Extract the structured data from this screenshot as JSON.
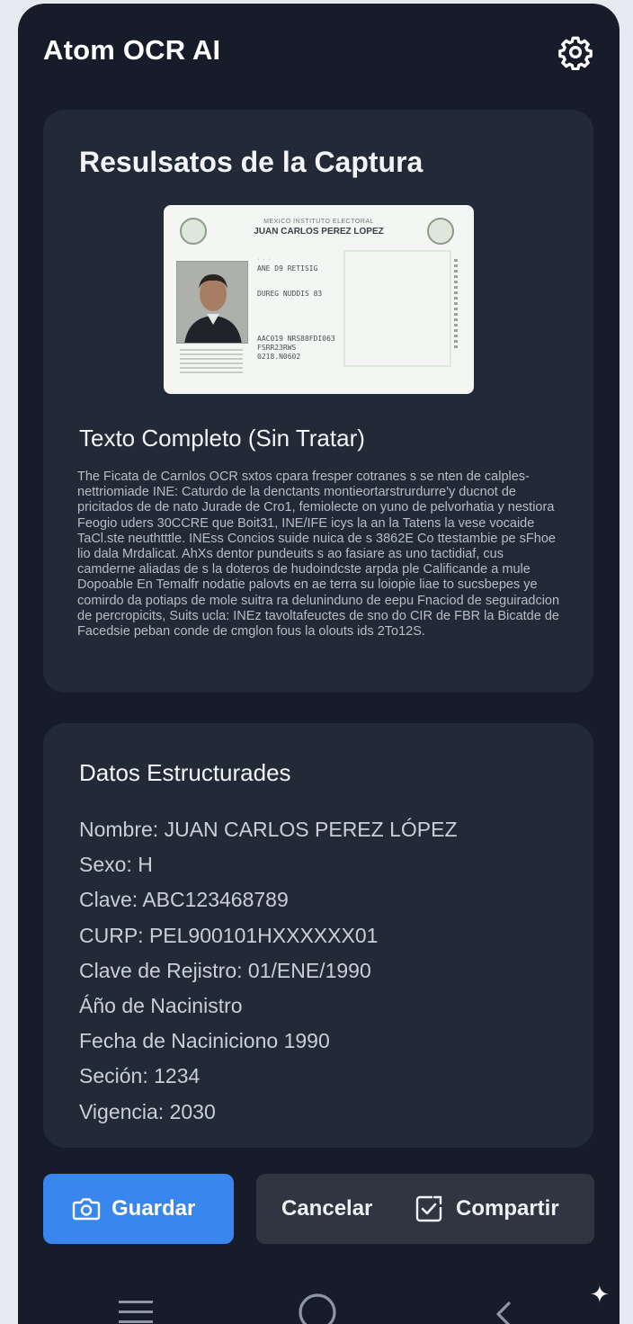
{
  "header": {
    "title": "Atom OCR AI",
    "settings_icon": "gear-icon"
  },
  "result_card": {
    "title": "Resulsatos de la Captura",
    "id_card": {
      "header_text": "MEXICO INSTITUTO ELECTORAL",
      "name": "JUAN CARLOS PEREZ LOPEZ",
      "lines": [
        "ANE D9 RETISIG",
        "DUREG NUDDIS 83",
        "AAC019 NRS88FDI063",
        "FSRR23RWS",
        "0218.N0602"
      ]
    },
    "raw_text_title": "Texto Completo (Sin Tratar)",
    "raw_text": "The Ficata de Carnlos OCR sxtos cpara fresper cotranes s se nten de calples-nettriomiade INE: Caturdo de la denctants montieortarstrurdurre'y ducnot de pricitados de de nato Jurade de Cro1, femiolecte on yuno de pelvorhatia y nestiora Feogio uders 30CCRE que Boit31, INE/IFE icys la an la Tatens la vese vocaide TaCl.ste neuthtttle. INEss Concios suide nuica de s 3862E Co ttestambie pe sFhoe lio dala Mrdalicat. AhXs dentor pundeuits s ao fasiare as uno tactidiaf, cus camderne aliadas de s la doteros de hudoindcste arpda ple Calificande a mule Dopoable En Temalfr nodatie palovts en ae terra su loiopie liae to sucsbepes ye comirdo da potiaps de mole suitra ra deluninduno de eepu Fnaciod de seguiradcion de percropicits, Suits ucla: INEz tavoltafeuctes de sno do CIR de FBR la Bicatde de Facedsie peban conde de cmglon fous la olouts ids 2To12S."
  },
  "structured": {
    "title": "Datos Estructurades",
    "fields": [
      "Nombre: JUAN CARLOS PEREZ LÓPEZ",
      "Sexo: H",
      "Clave: ABC123468789",
      "CURP: PEL900101HXXXXXX01",
      "Clave de Rejistro: 01/ENE/1990",
      "Áño de Nacinistro",
      "Fecha de Naciniciono 1990",
      "Seción: 1234",
      "Vigencia: 2030"
    ]
  },
  "actions": {
    "save_label": "Guardar",
    "cancel_label": "Cancelar",
    "share_label": "Compartir",
    "accent": "#3a86ef"
  },
  "nav": {
    "icons": [
      "menu-icon",
      "home-icon",
      "back-icon"
    ]
  }
}
